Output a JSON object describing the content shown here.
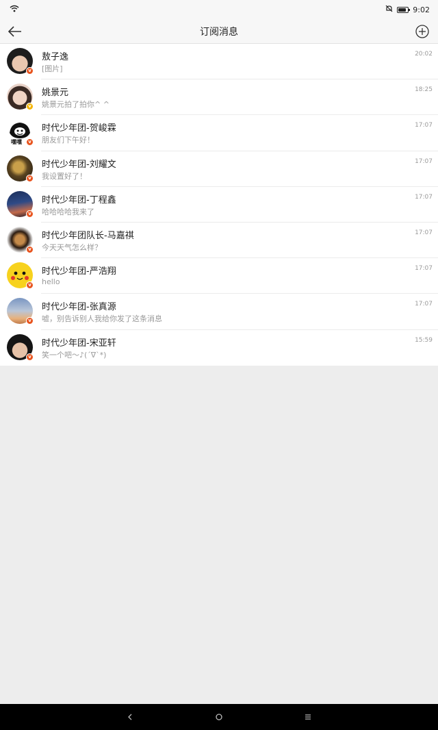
{
  "status_bar": {
    "time": "9:02"
  },
  "header": {
    "title": "订阅消息"
  },
  "messages": [
    {
      "name": "敖子逸",
      "preview": "[图片]",
      "time": "20:02",
      "badge": "red",
      "avatar": "a0"
    },
    {
      "name": "姚景元",
      "preview": "姚景元拍了拍你^ ^",
      "time": "18:25",
      "badge": "gold",
      "avatar": "a1"
    },
    {
      "name": "时代少年团-贺峻霖",
      "preview": "朋友们下午好！",
      "time": "17:07",
      "badge": "red",
      "avatar": "a2",
      "avatar_text": "嘿嘿"
    },
    {
      "name": "时代少年团-刘耀文",
      "preview": "我设置好了！",
      "time": "17:07",
      "badge": "red",
      "avatar": "a3"
    },
    {
      "name": "时代少年团-丁程鑫",
      "preview": "哈哈哈哈我来了",
      "time": "17:07",
      "badge": "red",
      "avatar": "a4"
    },
    {
      "name": "时代少年团队长-马嘉祺",
      "preview": "今天天气怎么样？",
      "time": "17:07",
      "badge": "red",
      "avatar": "a5"
    },
    {
      "name": "时代少年团-严浩翔",
      "preview": "hello",
      "time": "17:07",
      "badge": "red",
      "avatar": "a6"
    },
    {
      "name": "时代少年团-张真源",
      "preview": "嘘，别告诉别人我给你发了这条消息",
      "time": "17:07",
      "badge": "red",
      "avatar": "a7"
    },
    {
      "name": "时代少年团-宋亚轩",
      "preview": "笑一个吧～♪(´∇`*)",
      "time": "15:59",
      "badge": "red",
      "avatar": "a8"
    }
  ],
  "badge_label": "v",
  "colors": {
    "badge_red": "#e8541e",
    "badge_gold": "#f4b400",
    "background": "#ededed"
  }
}
